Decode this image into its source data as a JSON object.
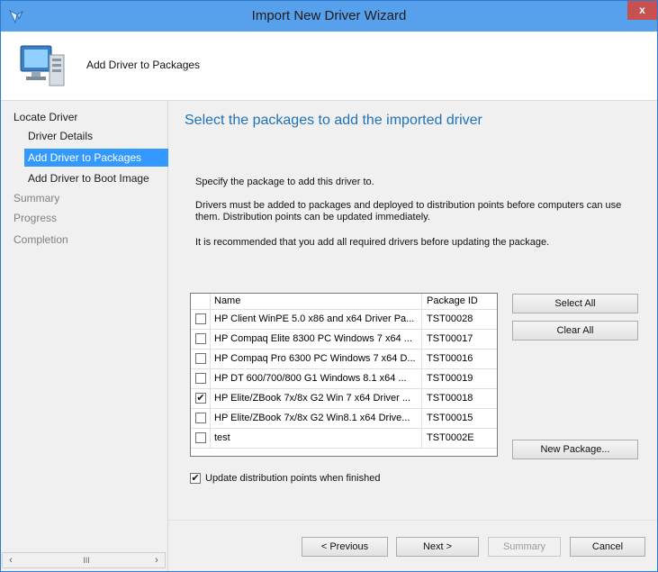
{
  "window": {
    "title": "Import New Driver Wizard",
    "close_glyph": "x"
  },
  "header": {
    "title": "Add Driver to Packages"
  },
  "sidebar": {
    "items": [
      {
        "label": "Locate Driver",
        "state": "normal"
      },
      {
        "label": "Driver Details",
        "state": "normal"
      },
      {
        "label": "Add Driver to Packages",
        "state": "active"
      },
      {
        "label": "Add Driver to Boot Image",
        "state": "normal"
      },
      {
        "label": "Summary",
        "state": "dim"
      },
      {
        "label": "Progress",
        "state": "dim"
      },
      {
        "label": "Completion",
        "state": "dim"
      }
    ],
    "scroll_thumb_glyph": "III"
  },
  "main": {
    "title": "Select the packages to add the imported driver",
    "para1": "Specify the package to add this driver to.",
    "para2a": "Drivers must be added to packages and deployed to distribution points before computers can use",
    "para2b": "them.  Distribution points can be updated immediately.",
    "para3": "It is recommended that you add all required drivers before updating the package."
  },
  "table": {
    "columns": [
      "Name",
      "Package ID"
    ],
    "rows": [
      {
        "checked": false,
        "name": "HP Client WinPE 5.0 x86 and x64 Driver Pa...",
        "id": "TST00028"
      },
      {
        "checked": false,
        "name": "HP Compaq Elite 8300 PC Windows 7 x64 ...",
        "id": "TST00017"
      },
      {
        "checked": false,
        "name": "HP Compaq Pro 6300 PC Windows 7 x64 D...",
        "id": "TST00016"
      },
      {
        "checked": false,
        "name": "HP DT 600/700/800 G1 Windows 8.1 x64 ...",
        "id": "TST00019"
      },
      {
        "checked": true,
        "name": "HP Elite/ZBook 7x/8x G2 Win 7 x64 Driver ...",
        "id": "TST00018"
      },
      {
        "checked": false,
        "name": "HP Elite/ZBook 7x/8x G2 Win8.1 x64 Drive...",
        "id": "TST00015"
      },
      {
        "checked": false,
        "name": "test",
        "id": "TST0002E"
      }
    ],
    "check_glyph": "✔"
  },
  "buttons": {
    "select_all": "Select All",
    "clear_all": "Clear All",
    "new_package": "New Package...",
    "previous": "< Previous",
    "next": "Next >",
    "summary": "Summary",
    "cancel": "Cancel"
  },
  "update_option": {
    "checked": true,
    "label": "Update distribution points when finished"
  },
  "colors": {
    "title_bar": "#56a0ec",
    "accent": "#3399ff",
    "heading": "#1e72b8"
  }
}
